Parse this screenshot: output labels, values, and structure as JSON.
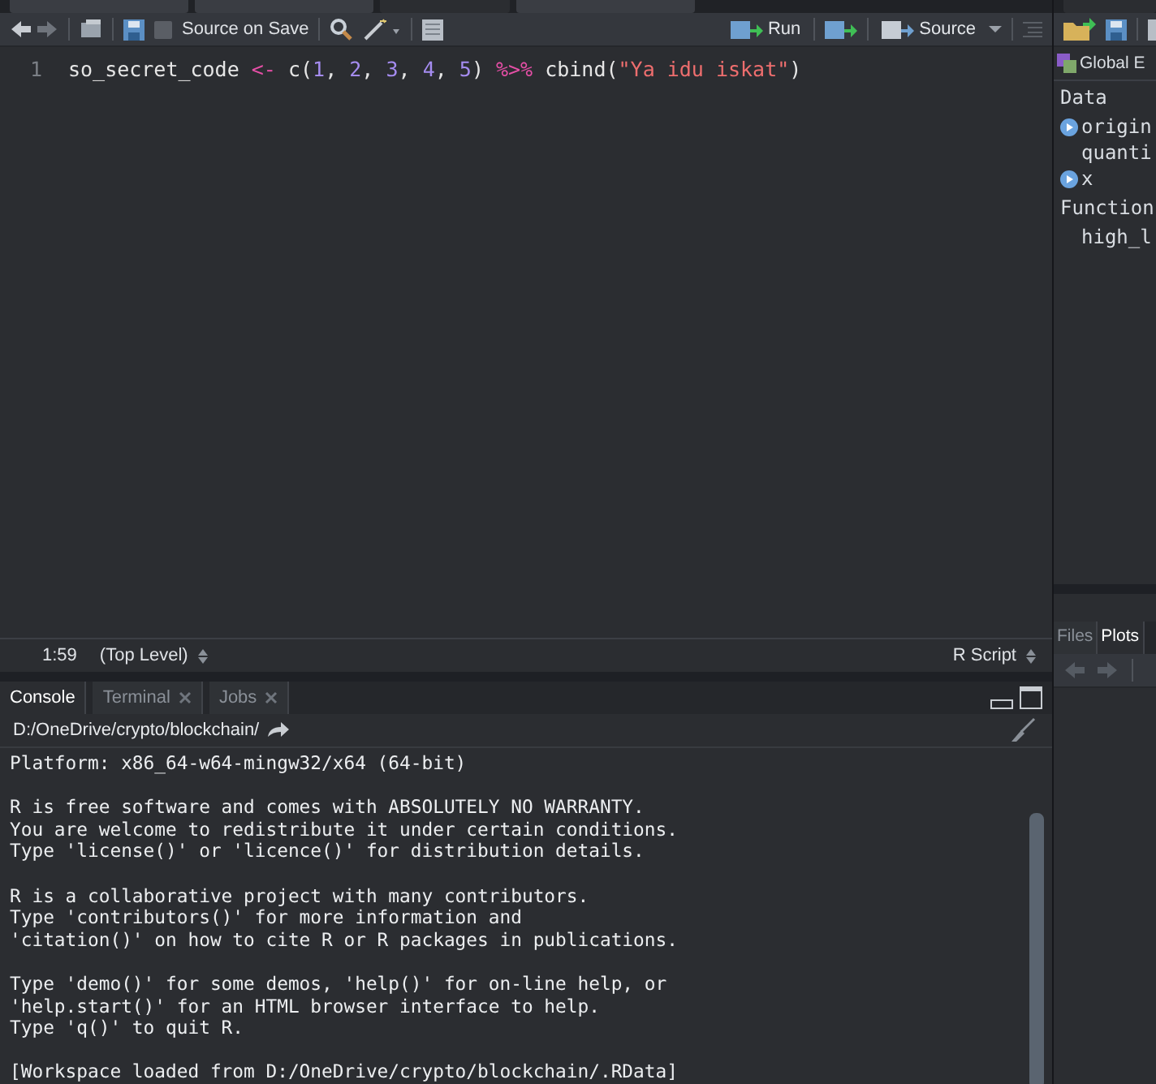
{
  "editor": {
    "document_tabs": [
      {
        "selected": false
      },
      {
        "selected": false
      },
      {
        "selected": true
      },
      {
        "selected": false
      }
    ],
    "toolbar": {
      "source_on_save": {
        "label": "Source on Save",
        "checked": false
      },
      "run": "Run",
      "source": "Source"
    },
    "lines": [
      {
        "number": "1",
        "tokens": [
          {
            "text": "so_secret_code ",
            "kind": "plain"
          },
          {
            "text": "<-",
            "kind": "operator"
          },
          {
            "text": " c(",
            "kind": "plain"
          },
          {
            "text": "1",
            "kind": "number"
          },
          {
            "text": ", ",
            "kind": "plain"
          },
          {
            "text": "2",
            "kind": "number"
          },
          {
            "text": ", ",
            "kind": "plain"
          },
          {
            "text": "3",
            "kind": "number"
          },
          {
            "text": ", ",
            "kind": "plain"
          },
          {
            "text": "4",
            "kind": "number"
          },
          {
            "text": ", ",
            "kind": "plain"
          },
          {
            "text": "5",
            "kind": "number"
          },
          {
            "text": ") ",
            "kind": "plain"
          },
          {
            "text": "%>%",
            "kind": "operator"
          },
          {
            "text": " cbind(",
            "kind": "plain"
          },
          {
            "text": "\"Ya idu iskat\"",
            "kind": "string"
          },
          {
            "text": ")",
            "kind": "plain"
          }
        ]
      }
    ],
    "status_bar": {
      "position": "1:59",
      "scope": "(Top Level)",
      "file_type": "R Script"
    }
  },
  "console": {
    "tabs": [
      {
        "label": "Console",
        "selected": true,
        "closable": false
      },
      {
        "label": "Terminal",
        "selected": false,
        "closable": true
      },
      {
        "label": "Jobs",
        "selected": false,
        "closable": true
      }
    ],
    "path": "D:/OneDrive/crypto/blockchain/",
    "output": [
      [
        "Platform: x86_64-w64-mingw32/x64 (64-bit)"
      ],
      [
        "R is free software and comes with ABSOLUTELY NO WARRANTY.",
        "You are welcome to redistribute it under certain conditions.",
        "Type 'license()' or 'licence()' for distribution details."
      ],
      [
        "R is a collaborative project with many contributors.",
        "Type 'contributors()' for more information and",
        "'citation()' on how to cite R or R packages in publications."
      ],
      [
        "Type 'demo()' for some demos, 'help()' for on-line help, or",
        "'help.start()' for an HTML browser interface to help.",
        "Type 'q()' to quit R."
      ],
      [
        "[Workspace loaded from D:/OneDrive/crypto/blockchain/.RData]"
      ]
    ]
  },
  "environment": {
    "scope": "Global E",
    "sections": [
      {
        "title": "Data",
        "items": [
          {
            "name": "origin",
            "expandable": true
          },
          {
            "name": "quanti",
            "expandable": false
          },
          {
            "name": "x",
            "expandable": true
          }
        ]
      },
      {
        "title": "Function",
        "items": [
          {
            "name": "high_l",
            "expandable": false
          }
        ]
      }
    ]
  },
  "files_pane": {
    "tabs": [
      {
        "label": "Files",
        "selected": false
      },
      {
        "label": "Plots",
        "selected": true
      }
    ]
  }
}
